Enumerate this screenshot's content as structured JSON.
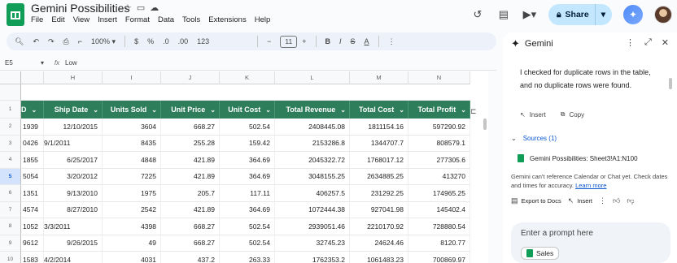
{
  "app": {
    "title": "Gemini Possibilities",
    "menu": [
      "File",
      "Edit",
      "View",
      "Insert",
      "Format",
      "Data",
      "Tools",
      "Extensions",
      "Help"
    ],
    "share_label": "Share"
  },
  "toolbar": {
    "zoom": "100%",
    "currency": "$",
    "percent": "%",
    "dec_dec": ".0",
    "dec_inc": ".00",
    "number_format": "123",
    "minus": "−",
    "font_size": "11",
    "plus": "+",
    "bold": "B",
    "italic": "I",
    "strike": "S",
    "text_color": "A",
    "more": "⋮"
  },
  "formula": {
    "cell_ref": "E5",
    "value": "Low"
  },
  "columns": [
    "H",
    "I",
    "J",
    "K",
    "L",
    "M",
    "N"
  ],
  "rows": [
    "1",
    "2",
    "3",
    "4",
    "5",
    "6",
    "7",
    "8",
    "9",
    "10"
  ],
  "table": {
    "headers": [
      "D",
      "Ship Date",
      "Units Sold",
      "Unit Price",
      "Unit Cost",
      "Total Revenue",
      "Total Cost",
      "Total Profit"
    ],
    "data": [
      [
        "1939",
        "12/10/2015",
        "3604",
        "668.27",
        "502.54",
        "2408445.08",
        "1811154.16",
        "597290.92"
      ],
      [
        "0426",
        "9/1/2011",
        "8435",
        "255.28",
        "159.42",
        "2153286.8",
        "1344707.7",
        "808579.1"
      ],
      [
        "1855",
        "6/25/2017",
        "4848",
        "421.89",
        "364.69",
        "2045322.72",
        "1768017.12",
        "277305.6"
      ],
      [
        "5054",
        "3/20/2012",
        "7225",
        "421.89",
        "364.69",
        "3048155.25",
        "2634885.25",
        "413270"
      ],
      [
        "1351",
        "9/13/2010",
        "1975",
        "205.7",
        "117.11",
        "406257.5",
        "231292.25",
        "174965.25"
      ],
      [
        "4574",
        "8/27/2010",
        "2542",
        "421.89",
        "364.69",
        "1072444.38",
        "927041.98",
        "145402.4"
      ],
      [
        "1052",
        "3/3/2011",
        "4398",
        "668.27",
        "502.54",
        "2939051.46",
        "2210170.92",
        "728880.54"
      ],
      [
        "9612",
        "9/26/2015",
        "49",
        "668.27",
        "502.54",
        "32745.23",
        "24624.46",
        "8120.77"
      ],
      [
        "1583",
        "4/2/2014",
        "4031",
        "437.2",
        "263.33",
        "1762353.2",
        "1061483.23",
        "700869.97"
      ]
    ]
  },
  "gemini": {
    "title": "Gemini",
    "message": "I checked for duplicate rows in the table, and no duplicate rows were found.",
    "insert_label": "Insert",
    "copy_label": "Copy",
    "sources_label": "Sources (1)",
    "source_item": "Gemini Possibilities: Sheet3!A1:N100",
    "note": "Gemini can't reference Calendar or Chat yet. Check dates and times for accuracy.",
    "learn_more": "Learn more",
    "export_label": "Export to Docs",
    "insert2_label": "Insert",
    "prompt_placeholder": "Enter a prompt here",
    "chip_label": "Sales"
  }
}
